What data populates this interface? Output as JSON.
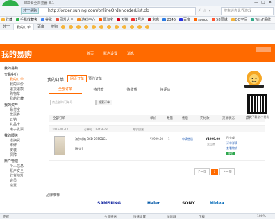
{
  "browser": {
    "title": "360安全浏览器 8.1",
    "site_badge": "苏宁易购",
    "url": "http://order.suning.com/onlineOrder/orderList.do",
    "search_placeholder": "搜索迷你世界游戏",
    "window_buttons": [
      "—",
      "□",
      "✕"
    ],
    "bookmarks": [
      {
        "label": "收藏",
        "color": "#f5b53c"
      },
      {
        "label": "手机收藏夹",
        "color": "#2fb04a"
      },
      {
        "label": "谷歌",
        "color": "#4285f4"
      },
      {
        "label": "网址大全",
        "color": "#e84d3d"
      },
      {
        "label": "游戏中心",
        "color": "#f08a24"
      },
      {
        "label": "爱淘宝",
        "color": "#ff5500"
      },
      {
        "label": "天猫",
        "color": "#d6001c"
      },
      {
        "label": "1号店",
        "color": "#e33"
      },
      {
        "label": "京东",
        "color": "#c9151e"
      },
      {
        "label": "2345",
        "color": "#2a7ae2"
      },
      {
        "label": "百度",
        "color": "#2932e1"
      },
      {
        "label": "sogou",
        "color": "#f60"
      },
      {
        "label": "58同城",
        "color": "#ff552e"
      },
      {
        "label": "QQ空间",
        "color": "#f5b53c"
      },
      {
        "label": "Win7系统",
        "color": "#3a8"
      }
    ],
    "tabs": [
      {
        "label": "苏宁",
        "active": false
      },
      {
        "label": "我的订单",
        "active": true
      },
      {
        "label": "百度",
        "active": false
      },
      {
        "label": "搜狗",
        "active": false
      }
    ]
  },
  "site": {
    "brand": "我的易购",
    "nav": [
      "首页",
      "账户设置",
      "消息"
    ]
  },
  "sidebar": [
    {
      "title": "我的易购",
      "items": []
    },
    {
      "title": "交易中心",
      "items": [
        "我的订单",
        "我的评价",
        "退货退款",
        "购物车",
        "我的收藏"
      ]
    },
    {
      "title": "我的资产",
      "items": [
        "易付宝",
        "优惠券",
        "云钻",
        "礼品卡",
        "电子发票"
      ]
    },
    {
      "title": "我的服务",
      "items": [
        "退换货",
        "维修",
        "安装",
        "保障"
      ]
    },
    {
      "title": "账户管理",
      "items": [
        "个人信息",
        "账户安全",
        "收货地址",
        "会员",
        "设置"
      ]
    }
  ],
  "orders": {
    "title": "我的订单",
    "tab_primary": "网页订单",
    "tab_secondary": "预约订单",
    "subtabs": [
      "全部订单",
      "待付款",
      "待收货",
      "待评价"
    ],
    "search_placeholder": "商品名称/订单号",
    "search_button": "搜索订单",
    "columns": [
      "全部订单",
      "单价",
      "数量",
      "售后",
      "实付款",
      "交易状态",
      "操作"
    ],
    "rows": [
      {
        "date": "2016-01-12",
        "order_no": "订单号 12345678",
        "store": "苏宁自营",
        "product": "海尔冰箱 BCD-215SDGL",
        "tag": "[服务]",
        "unit_price": "¥4999.00",
        "qty": "1",
        "after_sale": "申请售后",
        "paid": "¥4999.00",
        "paid_note": "含运费",
        "status": "已完成",
        "status_link": "订单详情",
        "status_link2": "查看物流",
        "badge": "评价"
      }
    ],
    "pager": [
      "上一页",
      "1",
      "下一页"
    ]
  },
  "qr": {
    "caption": "扫码下载 苏宁易购"
  },
  "brands": {
    "label": "品牌推荐",
    "items": [
      {
        "label": "SAMSUNG",
        "color": "#1428a0"
      },
      {
        "label": "Haier",
        "color": "#0056a6"
      },
      {
        "label": "SONY",
        "color": "#333"
      },
      {
        "label": "Midea",
        "color": "#0068b7"
      }
    ]
  },
  "statusbar": {
    "left": "完成",
    "items": [
      "今日特惠",
      "快速设置",
      "加速器",
      "下载",
      "100%"
    ]
  }
}
